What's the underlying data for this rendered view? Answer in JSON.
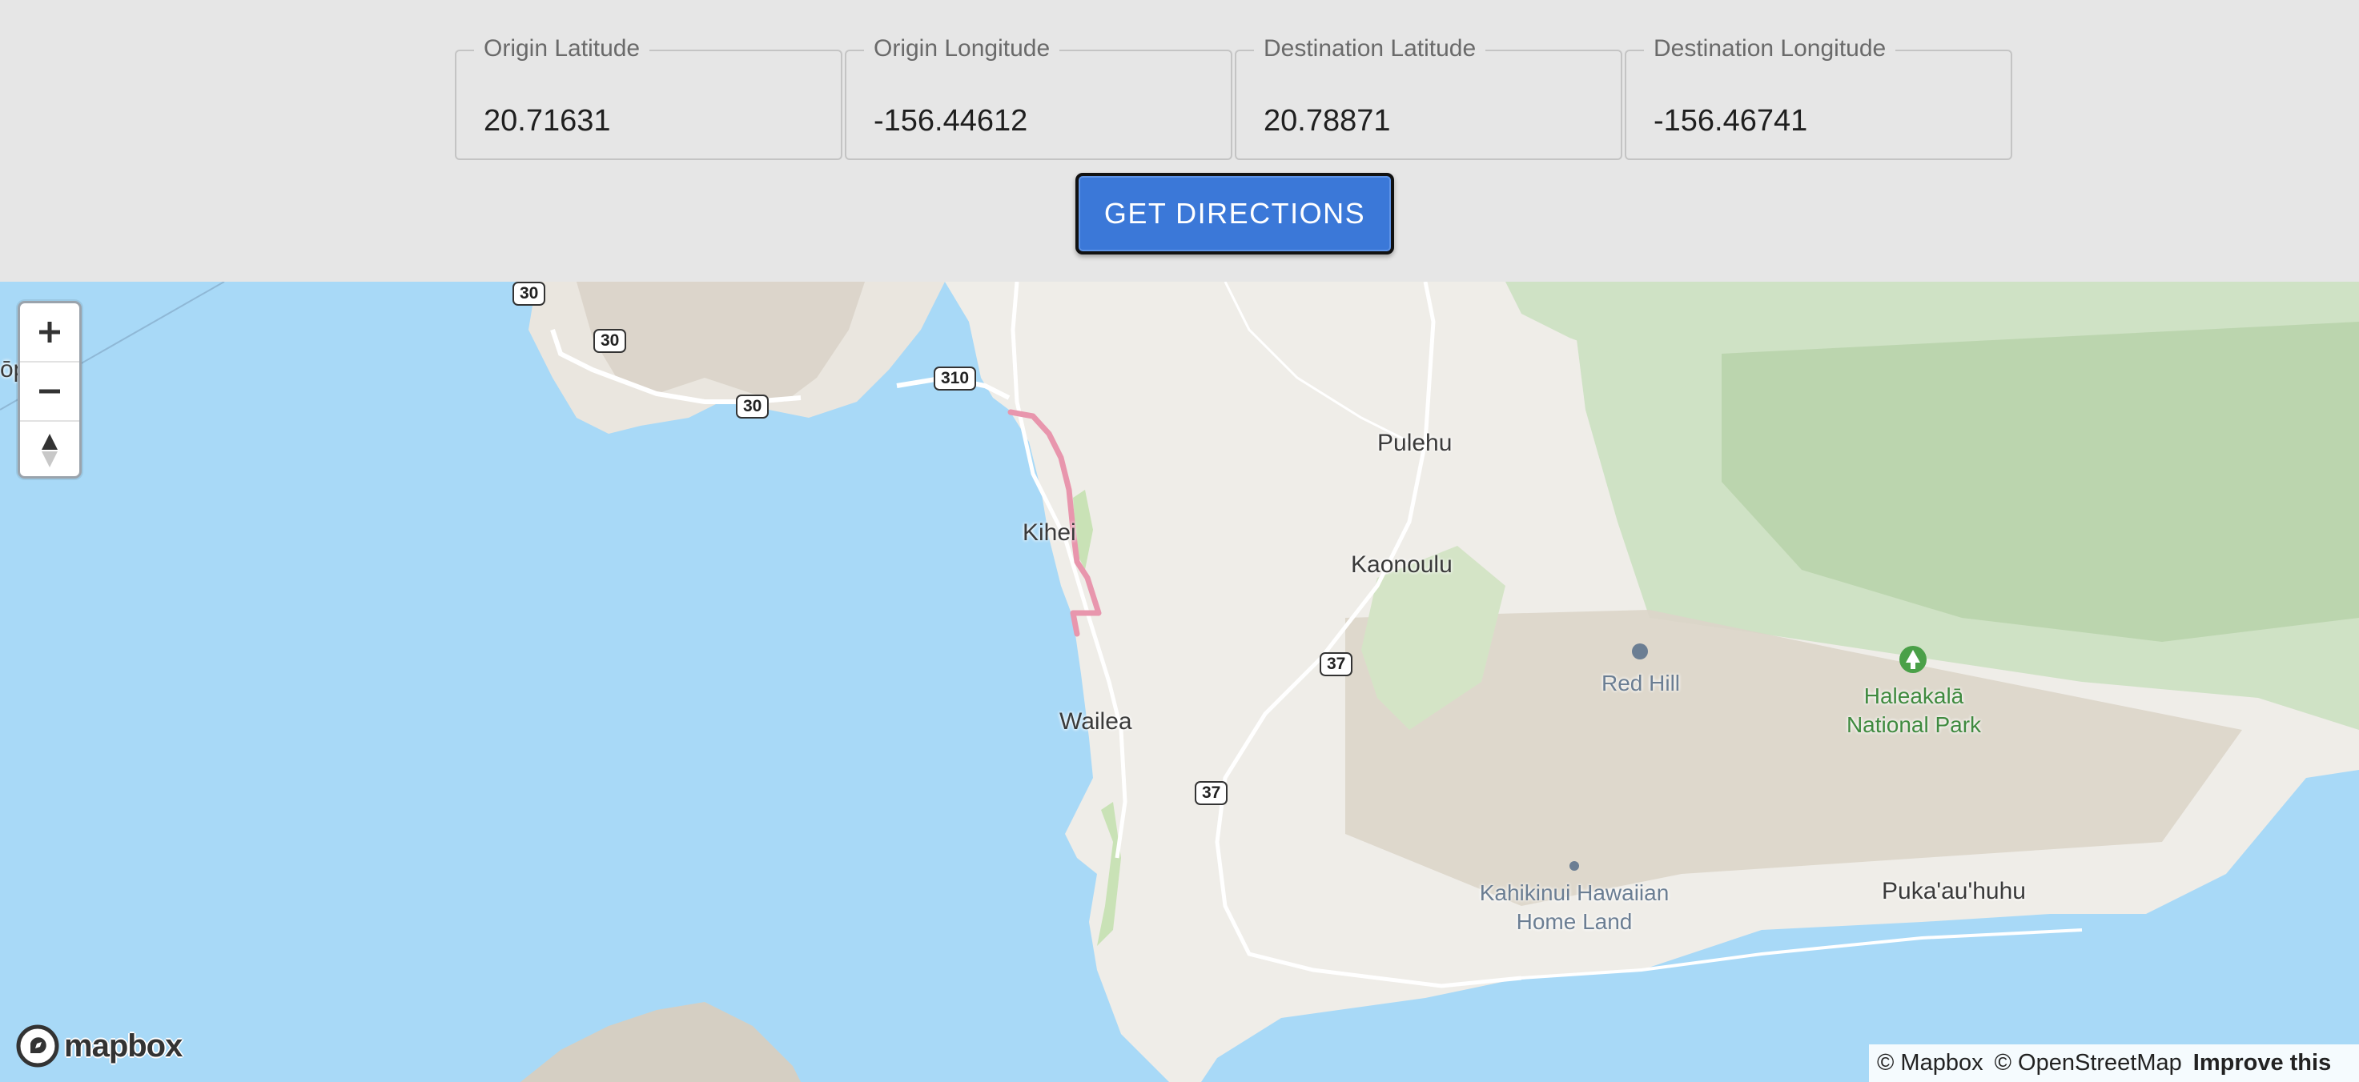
{
  "form": {
    "origin_lat": {
      "label": "Origin Latitude",
      "value": "20.71631"
    },
    "origin_lng": {
      "label": "Origin Longitude",
      "value": "-156.44612"
    },
    "dest_lat": {
      "label": "Destination Latitude",
      "value": "20.78871"
    },
    "dest_lng": {
      "label": "Destination Longitude",
      "value": "-156.46741"
    },
    "button_label": "GET DIRECTIONS"
  },
  "map": {
    "places": {
      "pulehu": "Pulehu",
      "kihei": "Kihei",
      "kaonoulu": "Kaonoulu",
      "wailea": "Wailea",
      "red_hill": "Red Hill",
      "park_line1": "Haleakalā",
      "park_line2": "National Park",
      "kahikinui_line1": "Kahikinui Hawaiian",
      "kahikinui_line2": "Home Land",
      "pukaauhuhu": "Puka'au'huhu",
      "edge_fragment": "ōp"
    },
    "route_shields": {
      "r30a": "30",
      "r30b": "30",
      "r30c": "30",
      "r310": "310",
      "r37a": "37",
      "r37b": "37"
    },
    "route_color": "#e896ad",
    "water_color": "#a8d9f7",
    "land_color": "#efede8",
    "controls": {
      "zoom_in": "+",
      "zoom_out": "−"
    },
    "logo_text": "mapbox",
    "attribution": {
      "mapbox": "© Mapbox",
      "osm": "© OpenStreetMap",
      "improve": "Improve this"
    }
  }
}
